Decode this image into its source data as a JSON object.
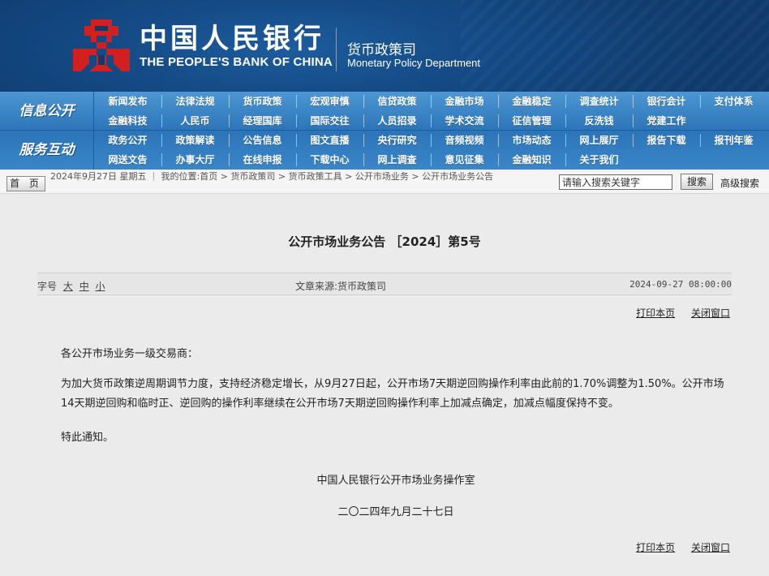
{
  "header": {
    "bank_name_cn": "中国人民银行",
    "bank_name_en": "THE PEOPLE'S BANK OF CHINA",
    "dept_name_cn": "货币政策司",
    "dept_name_en": "Monetary Policy Department",
    "logo_color": "#d21f1f"
  },
  "nav": {
    "info_title": "信息公开",
    "service_title": "服务互动",
    "row1": [
      "新闻发布",
      "法律法规",
      "货币政策",
      "宏观审慎",
      "信贷政策",
      "金融市场",
      "金融稳定",
      "调查统计",
      "银行会计",
      "支付体系"
    ],
    "row2": [
      "金融科技",
      "人民币",
      "经理国库",
      "国际交往",
      "人员招录",
      "学术交流",
      "征信管理",
      "反洗钱",
      "党建工作"
    ],
    "row3": [
      "政务公开",
      "政策解读",
      "公告信息",
      "图文直播",
      "央行研究",
      "音频视频",
      "市场动态",
      "网上展厅",
      "报告下载",
      "报刊年鉴"
    ],
    "row4": [
      "网送文告",
      "办事大厅",
      "在线申报",
      "下载中心",
      "网上调查",
      "意见征集",
      "金融知识",
      "关于我们"
    ]
  },
  "breadcrumb": {
    "home_label": "首 页",
    "date_text": "2024年9月27日 星期五",
    "location_label": "我的位置:",
    "items": [
      "首页",
      "货币政策司",
      "货币政策工具",
      "公开市场业务",
      "公开市场业务公告"
    ],
    "separator": ">"
  },
  "search": {
    "placeholder": "请输入搜索关键字",
    "button_label": "搜索",
    "advanced_label": "高级搜索"
  },
  "article": {
    "title": "公开市场业务公告 ［2024］第5号",
    "font_size_label": "字号",
    "font_large": "大",
    "font_medium": "中",
    "font_small": "小",
    "source_label": "文章来源:",
    "source": "货币政策司",
    "datetime": "2024-09-27 08:00:00",
    "print_label": "打印本页",
    "close_label": "关闭窗口",
    "salutation": "各公开市场业务一级交易商：",
    "body": "为加大货币政策逆周期调节力度，支持经济稳定增长，从9月27日起，公开市场7天期逆回购操作利率由此前的1.70%调整为1.50%。公开市场14天期逆回购和临时正、逆回购的操作利率继续在公开市场7天期逆回购操作利率上加减点确定，加减点幅度保持不变。",
    "notice": "特此通知。",
    "signature": "中国人民银行公开市场业务操作室",
    "sign_date": "二〇二四年九月二十七日"
  }
}
